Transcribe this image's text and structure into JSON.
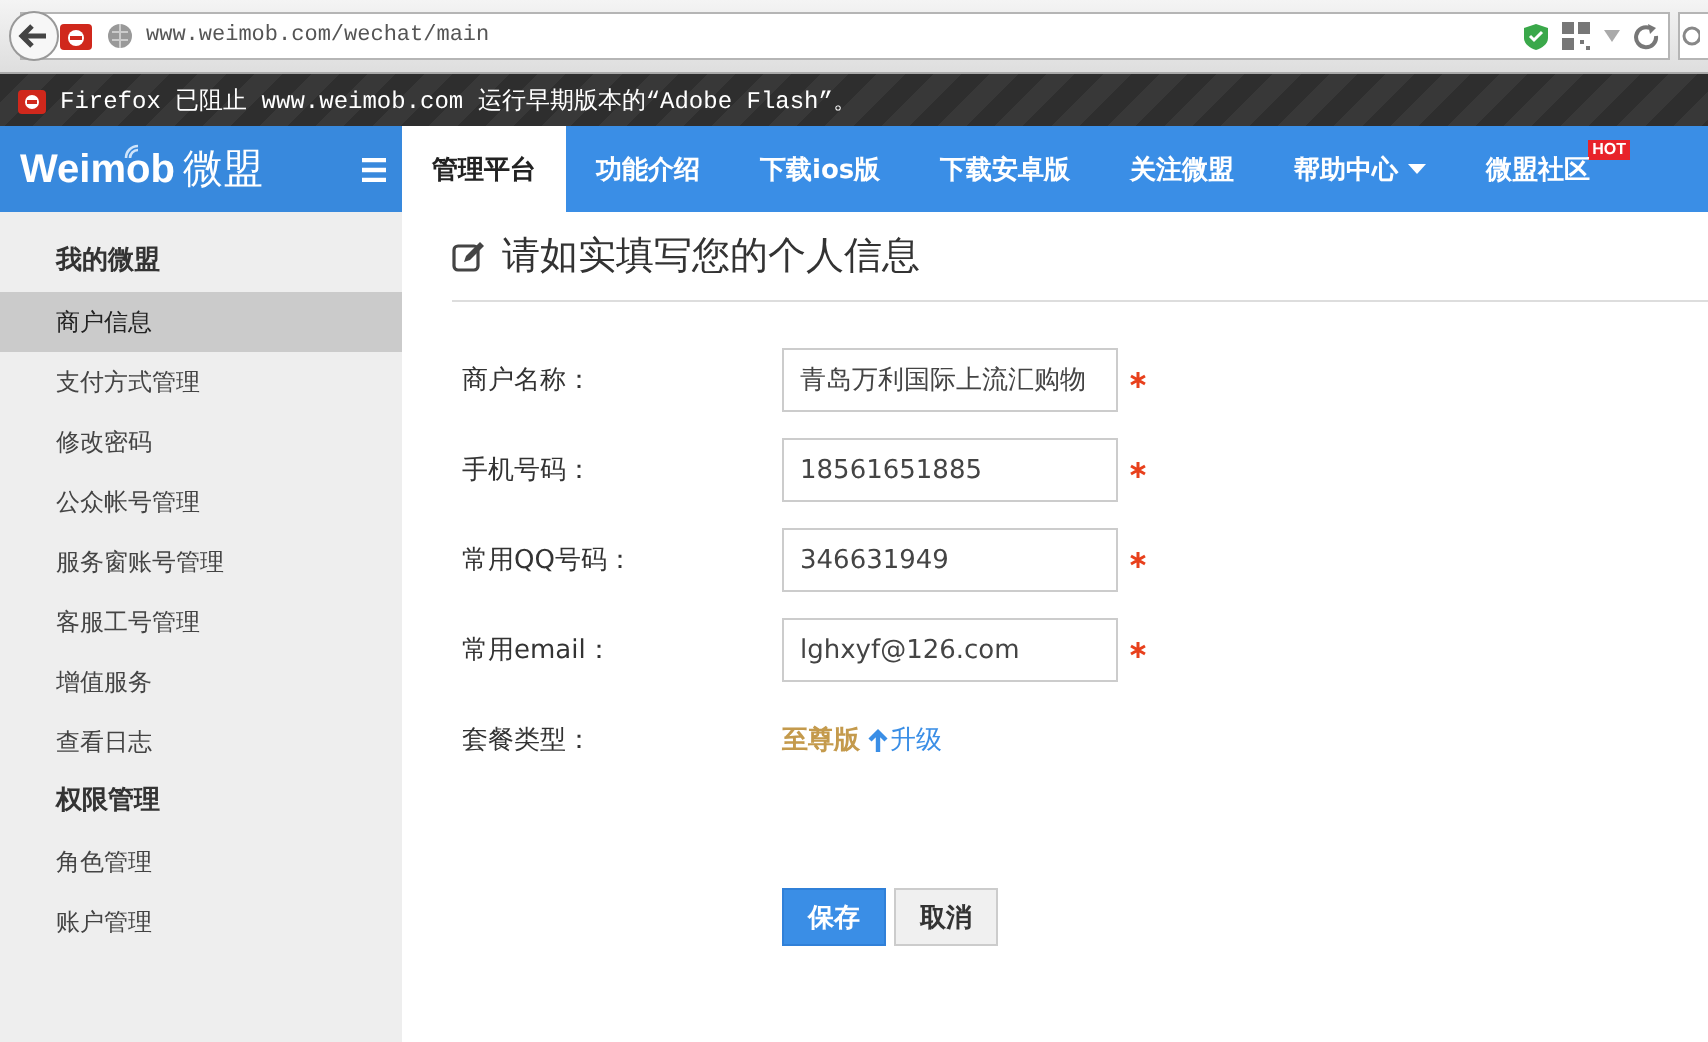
{
  "browser": {
    "url": "www.weimob.com/wechat/main"
  },
  "notification": {
    "text": "Firefox 已阻止 www.weimob.com 运行早期版本的“Adobe Flash”。"
  },
  "logo": {
    "text": "Weimob",
    "suffix": "微盟"
  },
  "nav": [
    {
      "label": "管理平台",
      "selected": true,
      "dropdown": false
    },
    {
      "label": "功能介绍",
      "selected": false,
      "dropdown": false
    },
    {
      "label": "下载ios版",
      "selected": false,
      "dropdown": false
    },
    {
      "label": "下载安卓版",
      "selected": false,
      "dropdown": false
    },
    {
      "label": "关注微盟",
      "selected": false,
      "dropdown": false
    },
    {
      "label": "帮助中心",
      "selected": false,
      "dropdown": true
    },
    {
      "label": "微盟社区",
      "selected": false,
      "dropdown": false,
      "badge": "HOT"
    }
  ],
  "sidebar": [
    {
      "heading": "我的微盟",
      "items": [
        {
          "label": "商户信息",
          "selected": true
        },
        {
          "label": "支付方式管理",
          "selected": false
        },
        {
          "label": "修改密码",
          "selected": false
        },
        {
          "label": "公众帐号管理",
          "selected": false
        },
        {
          "label": "服务窗账号管理",
          "selected": false
        },
        {
          "label": "客服工号管理",
          "selected": false
        },
        {
          "label": "增值服务",
          "selected": false
        },
        {
          "label": "查看日志",
          "selected": false
        }
      ]
    },
    {
      "heading": "权限管理",
      "items": [
        {
          "label": "角色管理",
          "selected": false
        },
        {
          "label": "账户管理",
          "selected": false
        }
      ]
    }
  ],
  "page_title": "请如实填写您的个人信息",
  "fields": [
    {
      "kind": "input",
      "label": "商户名称：",
      "value": "青岛万利国际上流汇购物",
      "required": true
    },
    {
      "kind": "input",
      "label": "手机号码：",
      "value": "18561651885",
      "required": true
    },
    {
      "kind": "input",
      "label": "常用QQ号码：",
      "value": "346631949",
      "required": true
    },
    {
      "kind": "input",
      "label": "常用email：",
      "value": "lghxyf@126.com",
      "required": true
    },
    {
      "kind": "plan",
      "label": "套餐类型：",
      "value": "至尊版",
      "link": "升级"
    }
  ],
  "buttons": [
    {
      "label": "保存",
      "kind": "primary"
    },
    {
      "label": "取消",
      "kind": "default"
    }
  ]
}
